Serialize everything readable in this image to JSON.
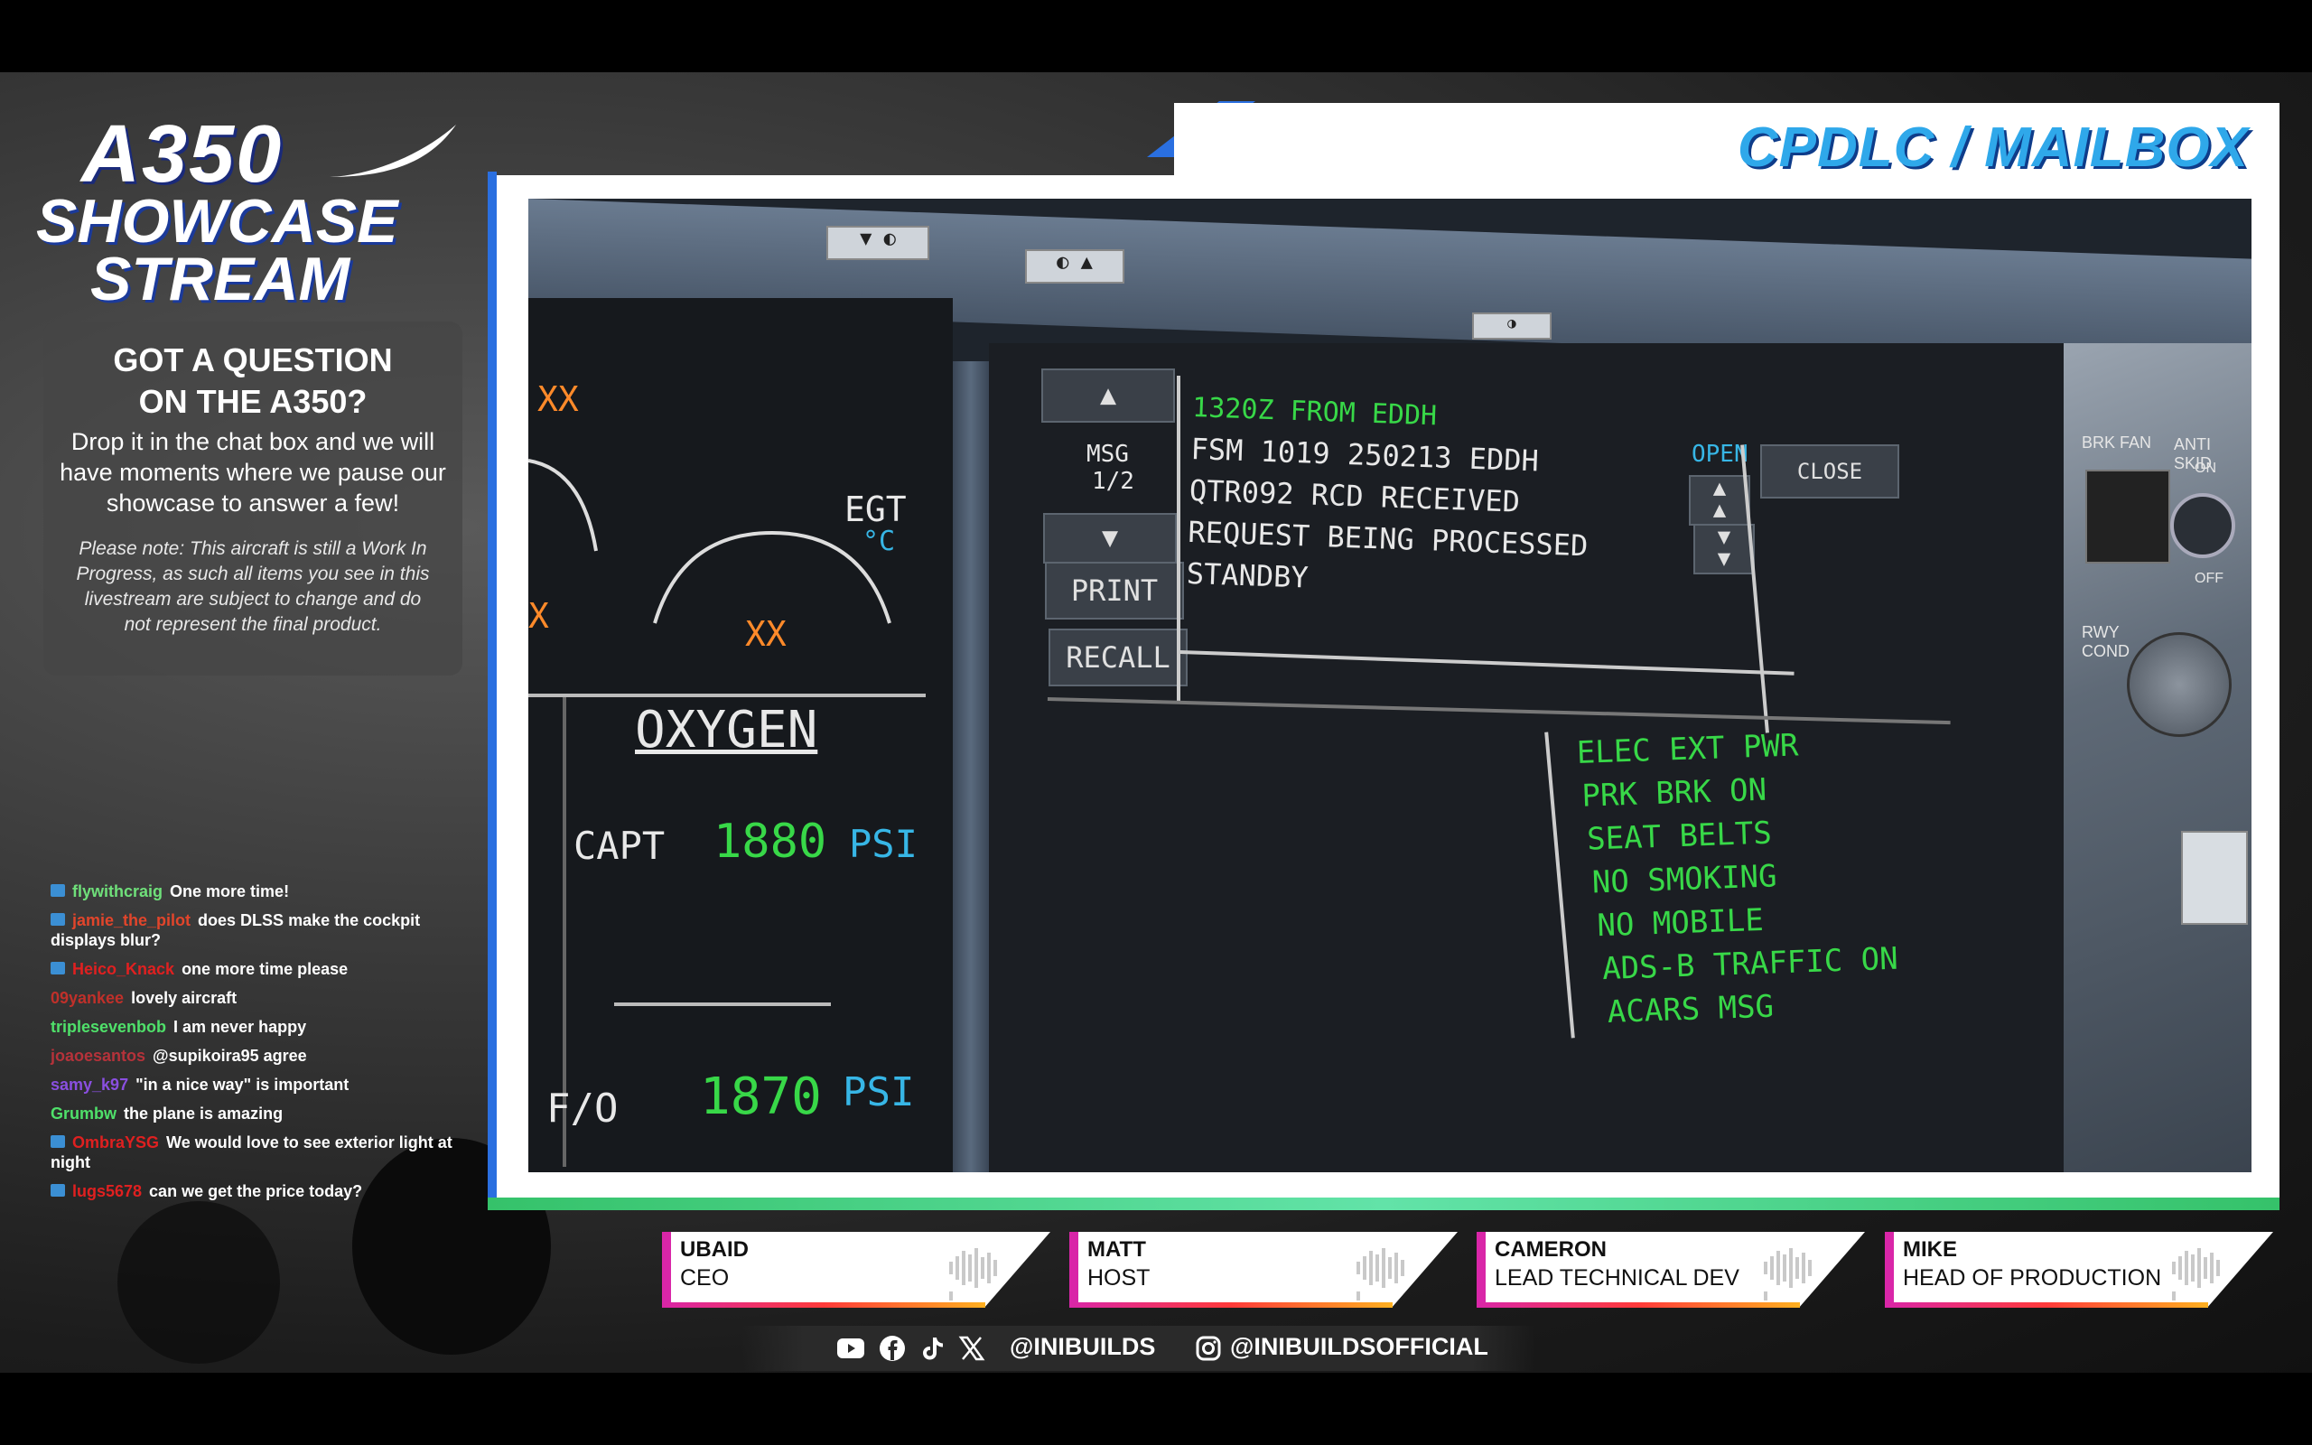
{
  "logo": {
    "line1": "A350",
    "line2": "SHOWCASE",
    "line3": "STREAM"
  },
  "question_box": {
    "title_line1": "GOT A QUESTION",
    "title_line2": "ON THE A350?",
    "body": "Drop it in the chat box and we will have moments where we pause our showcase to answer a few!",
    "note": "Please note: This aircraft is still a Work In Progress, as such all items you see in this livestream are subject to change and do not represent the final product."
  },
  "chat": [
    {
      "user": "flywithcraig",
      "text": "One more time!",
      "badge": true,
      "color": "#6fe07a"
    },
    {
      "user": "jamie_the_pilot",
      "text": "does DLSS make the cockpit displays blur?",
      "badge": true,
      "color": "#e2452b"
    },
    {
      "user": "Heico_Knack",
      "text": "one more time please",
      "badge": true,
      "color": "#e02020"
    },
    {
      "user": "09yankee",
      "text": "lovely aircraft",
      "badge": false,
      "color": "#c0302a"
    },
    {
      "user": "triplesevenbob",
      "text": "I am never happy",
      "badge": false,
      "color": "#4fe06a"
    },
    {
      "user": "joaoesantos",
      "text": "@supikoira95 agree",
      "badge": false,
      "color": "#b5323a"
    },
    {
      "user": "samy_k97",
      "text": "\"in a nice way\" is important",
      "badge": false,
      "color": "#8a4fe0"
    },
    {
      "user": "Grumbw",
      "text": "the plane is amazing",
      "badge": false,
      "color": "#4fe06a"
    },
    {
      "user": "OmbraYSG",
      "text": "We would love to see exterior light at night",
      "badge": true,
      "color": "#e02020"
    },
    {
      "user": "lugs5678",
      "text": "can we get the price today?",
      "badge": true,
      "color": "#e02020"
    }
  ],
  "section_title": "CPDLC / MAILBOX",
  "cockpit": {
    "left": {
      "xx_top": "XX",
      "xx_mid": "X",
      "egt_label": "EGT",
      "egt_unit": "°C",
      "egt_value": "XX",
      "oxygen_title": "OXYGEN",
      "capt_label": "CAPT",
      "capt_value": "1880",
      "capt_unit": "PSI",
      "fo_label": "F/O",
      "fo_value": "1870",
      "fo_unit": "PSI"
    },
    "mailbox": {
      "msg_label": "MSG",
      "msg_page": "1/2",
      "print": "PRINT",
      "recall": "RECALL",
      "open": "OPEN",
      "close": "CLOSE",
      "header": "1320Z FROM EDDH",
      "lines": [
        "FSM 1019 250213 EDDH",
        "QTR092 RCD RECEIVED",
        "REQUEST BEING PROCESSED",
        "STANDBY"
      ]
    },
    "memo": [
      "ELEC EXT PWR",
      "PRK BRK ON",
      "SEAT BELTS",
      "NO SMOKING",
      "NO MOBILE",
      "ADS-B TRAFFIC ON",
      "ACARS MSG"
    ],
    "overhead": {
      "brk_fan": "BRK FAN",
      "anti_skid": "ANTI SKID",
      "on": "ON",
      "off": "OFF",
      "rwy_cond": "RWY COND"
    }
  },
  "presenters": [
    {
      "name": "UBAID",
      "role": "CEO"
    },
    {
      "name": "MATT",
      "role": "HOST"
    },
    {
      "name": "CAMERON",
      "role": "LEAD TECHNICAL DEV"
    },
    {
      "name": "MIKE",
      "role": "HEAD OF PRODUCTION"
    }
  ],
  "socials": {
    "handle1": "@INIBUILDS",
    "handle2": "@INIBUILDSOFFICIAL",
    "icons": [
      "youtube-icon",
      "facebook-icon",
      "tiktok-icon",
      "x-icon",
      "instagram-icon"
    ]
  },
  "colors": {
    "accent_blue": "#2fa8ea",
    "display_green": "#38d848",
    "display_cyan": "#37b6e6",
    "presenter_pink": "#d926a8",
    "frame_green": "#35c26a"
  }
}
